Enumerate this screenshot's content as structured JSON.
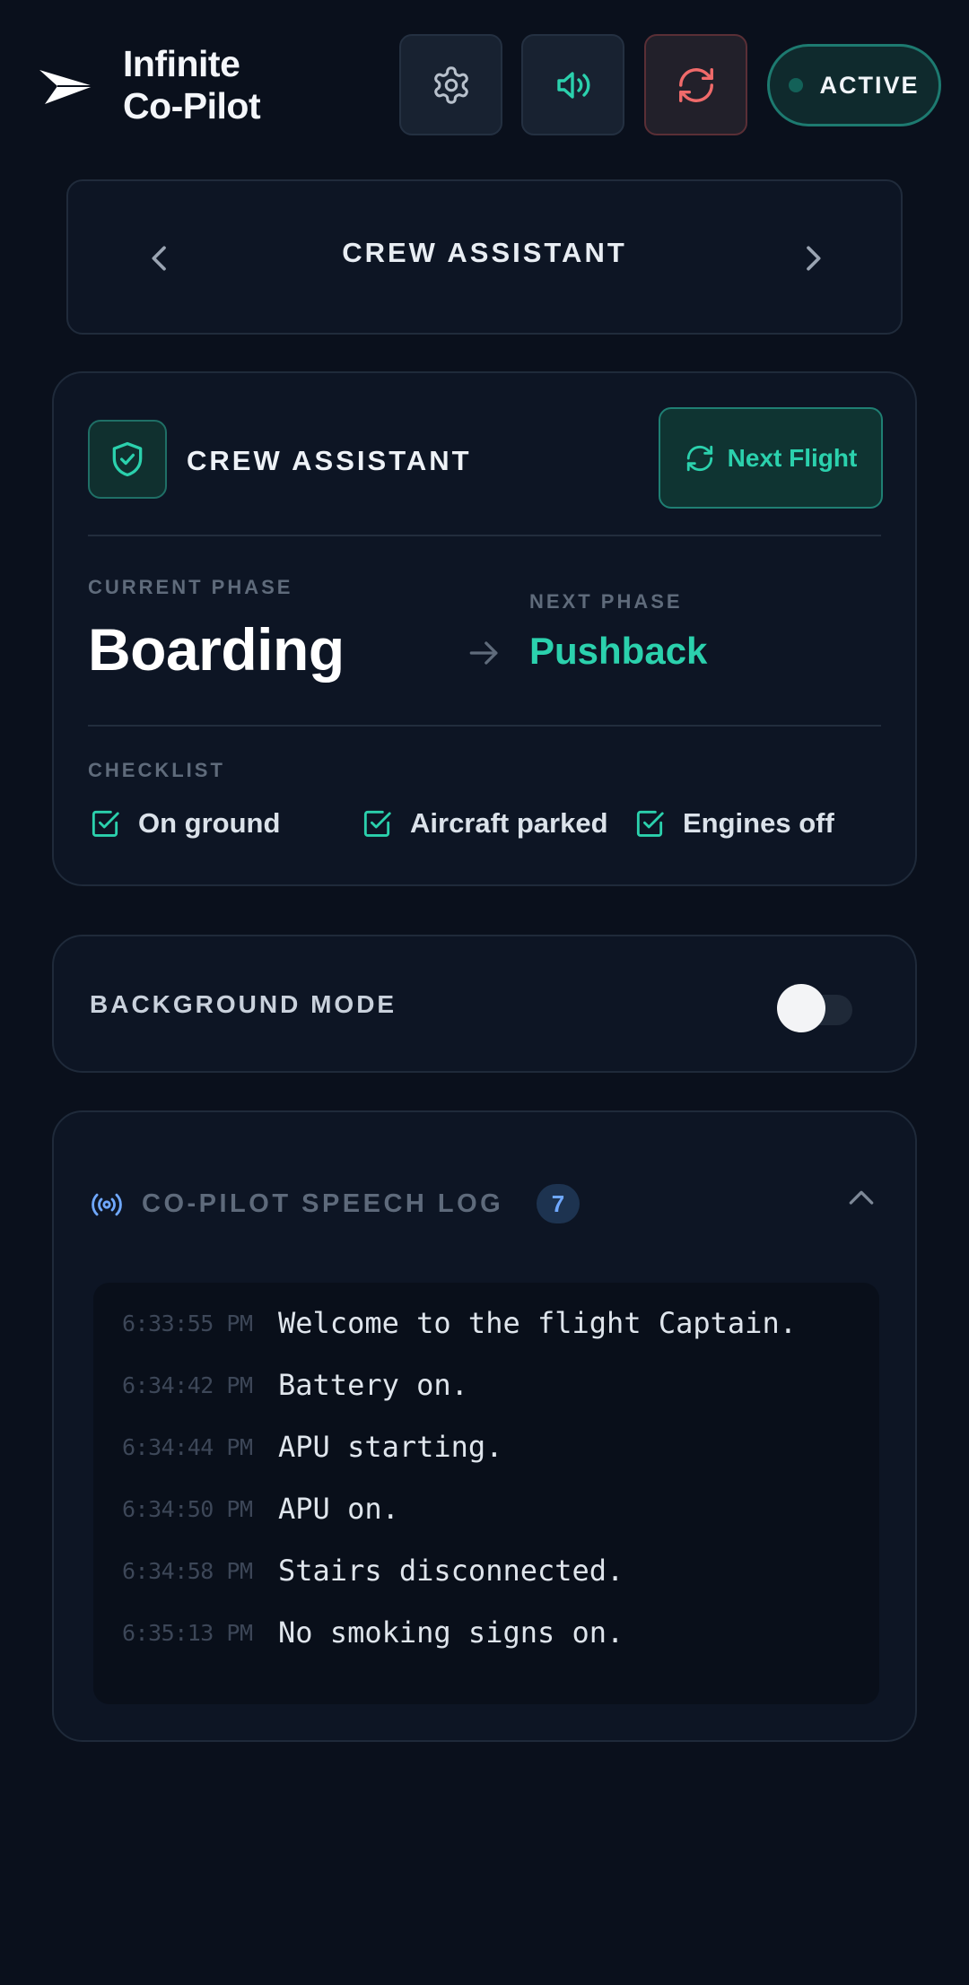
{
  "app": {
    "name": "Infinite Co-Pilot",
    "name_line1": "Infinite",
    "name_line2": "Co-Pilot"
  },
  "header": {
    "status_label": "ACTIVE",
    "icons": [
      "settings-gear-icon",
      "speaker-volume-icon",
      "refresh-icon"
    ]
  },
  "carousel": {
    "title": "CREW ASSISTANT"
  },
  "crew_card": {
    "title": "CREW ASSISTANT",
    "next_flight_label": "Next Flight",
    "current_phase_label": "CURRENT PHASE",
    "current_phase": "Boarding",
    "next_phase_label": "NEXT PHASE",
    "next_phase": "Pushback",
    "checklist_label": "CHECKLIST",
    "checklist": [
      {
        "label": "On ground",
        "checked": true
      },
      {
        "label": "Aircraft parked",
        "checked": true
      },
      {
        "label": "Engines off",
        "checked": true
      }
    ]
  },
  "background_mode": {
    "label": "BACKGROUND MODE",
    "enabled": false
  },
  "speech_log": {
    "title": "CO-PILOT SPEECH LOG",
    "count": "7",
    "entries": [
      {
        "time": "6:33:55 PM",
        "text": "Welcome to the flight Captain."
      },
      {
        "time": "6:34:42 PM",
        "text": "Battery on."
      },
      {
        "time": "6:34:44 PM",
        "text": "APU starting."
      },
      {
        "time": "6:34:50 PM",
        "text": "APU on."
      },
      {
        "time": "6:34:58 PM",
        "text": "Stairs disconnected."
      },
      {
        "time": "6:35:13 PM",
        "text": "No smoking signs on."
      }
    ]
  },
  "colors": {
    "background": "#0a101c",
    "accent": "#2bd1ad",
    "reset_red": "#f06a6a",
    "badge_blue": "#6fa8ff"
  }
}
